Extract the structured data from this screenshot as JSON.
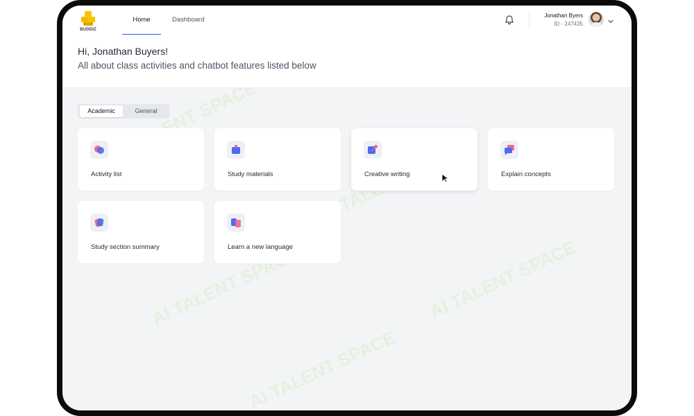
{
  "app": {
    "logo_text": "BUDDIZ"
  },
  "nav": {
    "tabs": [
      {
        "label": "Home",
        "active": true
      },
      {
        "label": "Dashboard",
        "active": false
      }
    ]
  },
  "user": {
    "name": "Jonathan Byers",
    "id": "ID - 247435"
  },
  "greeting": {
    "title": "Hi, Jonathan Buyers!",
    "subtitle": "All about class activities and chatbot features listed below"
  },
  "segment": {
    "options": [
      {
        "label": "Academic",
        "selected": true
      },
      {
        "label": "General",
        "selected": false
      }
    ]
  },
  "cards": [
    {
      "label": "Activity list",
      "icon": "activity-list-icon"
    },
    {
      "label": "Study materials",
      "icon": "study-materials-icon"
    },
    {
      "label": "Creative writing",
      "icon": "creative-writing-icon"
    },
    {
      "label": "Explain concepts",
      "icon": "explain-concepts-icon"
    },
    {
      "label": "Study section summary",
      "icon": "summary-icon"
    },
    {
      "label": "Learn a new language",
      "icon": "language-icon"
    }
  ],
  "watermark": {
    "text": "AI TALENT SPACE"
  },
  "colors": {
    "accent": "#3b5bdb",
    "icon_blue": "#4f6bed",
    "icon_pink": "#f06595",
    "page_bg": "#f3f4f6",
    "watermark": "#84cc16"
  }
}
